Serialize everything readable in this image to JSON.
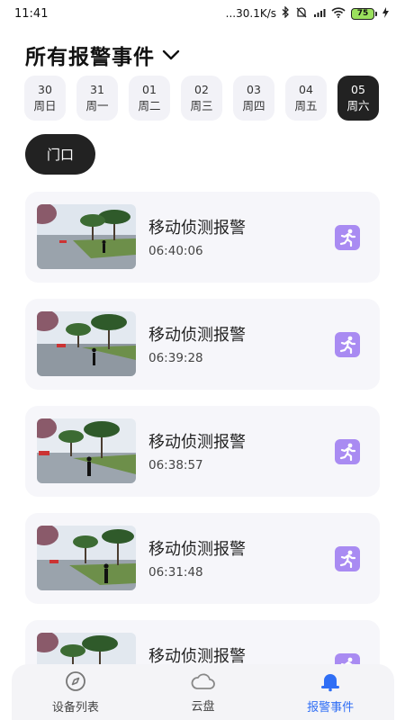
{
  "status_bar": {
    "time": "11:41",
    "net_speed": "...30.1K/s",
    "battery": "75"
  },
  "header": {
    "title": "所有报警事件"
  },
  "dates": [
    {
      "day": "30",
      "weekday": "周日",
      "selected": false
    },
    {
      "day": "31",
      "weekday": "周一",
      "selected": false
    },
    {
      "day": "01",
      "weekday": "周二",
      "selected": false
    },
    {
      "day": "02",
      "weekday": "周三",
      "selected": false
    },
    {
      "day": "03",
      "weekday": "周四",
      "selected": false
    },
    {
      "day": "04",
      "weekday": "周五",
      "selected": false
    },
    {
      "day": "05",
      "weekday": "周六",
      "selected": true
    }
  ],
  "filter": {
    "label": "门口"
  },
  "events": [
    {
      "title": "移动侦测报警",
      "time": "06:40:06",
      "icon": "running-person-icon"
    },
    {
      "title": "移动侦测报警",
      "time": "06:39:28",
      "icon": "running-person-icon"
    },
    {
      "title": "移动侦测报警",
      "time": "06:38:57",
      "icon": "running-person-icon"
    },
    {
      "title": "移动侦测报警",
      "time": "06:31:48",
      "icon": "running-person-icon"
    },
    {
      "title": "移动侦测报警",
      "time": "",
      "icon": "running-person-icon"
    }
  ],
  "tabs": [
    {
      "label": "设备列表",
      "icon": "compass-icon",
      "active": false
    },
    {
      "label": "云盘",
      "icon": "cloud-icon",
      "active": false
    },
    {
      "label": "报警事件",
      "icon": "bell-icon",
      "active": true
    }
  ],
  "colors": {
    "accent": "#2f6ef5",
    "event_icon": "#a98bf2",
    "chip_active": "#222222",
    "card_bg": "#f6f6fa"
  }
}
